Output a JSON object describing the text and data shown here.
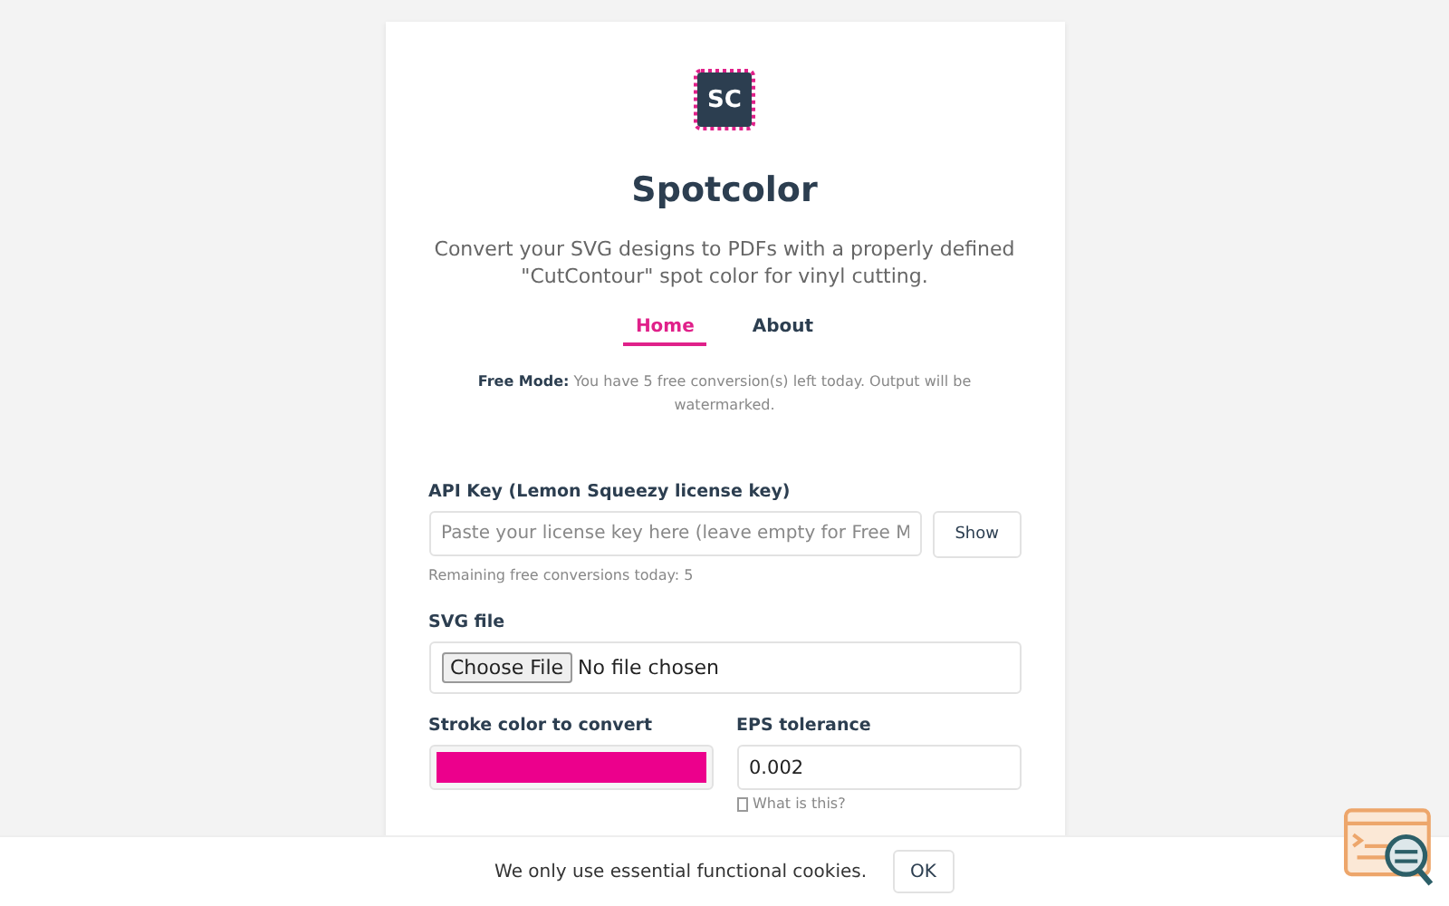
{
  "logo": {
    "text": "SC"
  },
  "title": "Spotcolor",
  "description": "Convert your SVG designs to PDFs with a properly defined \"CutContour\" spot color for vinyl cutting.",
  "tabs": [
    {
      "label": "Home",
      "selected": true
    },
    {
      "label": "About",
      "selected": false
    }
  ],
  "notice": "**Free Mode:** You have 5 free conversion(s) left today. Output will be watermarked.",
  "api_key": {
    "label": "API Key (Lemon Squeezy license key)",
    "placeholder": "Paste your license key here (leave empty for Free M",
    "button": "Show",
    "hint": "Remaining free conversions today: 5"
  },
  "svg_file": {
    "label": "SVG file",
    "button": "Choose File",
    "status": "No file chosen"
  },
  "stroke_color": {
    "label": "Stroke color to convert",
    "color": "#ec008c"
  },
  "eps_tolerance": {
    "label": "EPS tolerance",
    "value": "0.002",
    "help": "What is this?"
  },
  "cookie_bar": {
    "message": "We only use essential functional cookies.",
    "button": "OK"
  }
}
